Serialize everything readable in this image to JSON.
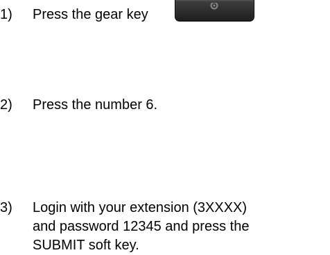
{
  "steps": [
    {
      "number": "1)",
      "text": "Press the gear key",
      "key_icon": "gear-icon"
    },
    {
      "number": "2)",
      "text": "Press the number 6."
    },
    {
      "number": "3)",
      "lines": [
        "Login with your extension (3XXXX)",
        "and password 12345 and press the",
        "SUBMIT soft key."
      ]
    }
  ]
}
